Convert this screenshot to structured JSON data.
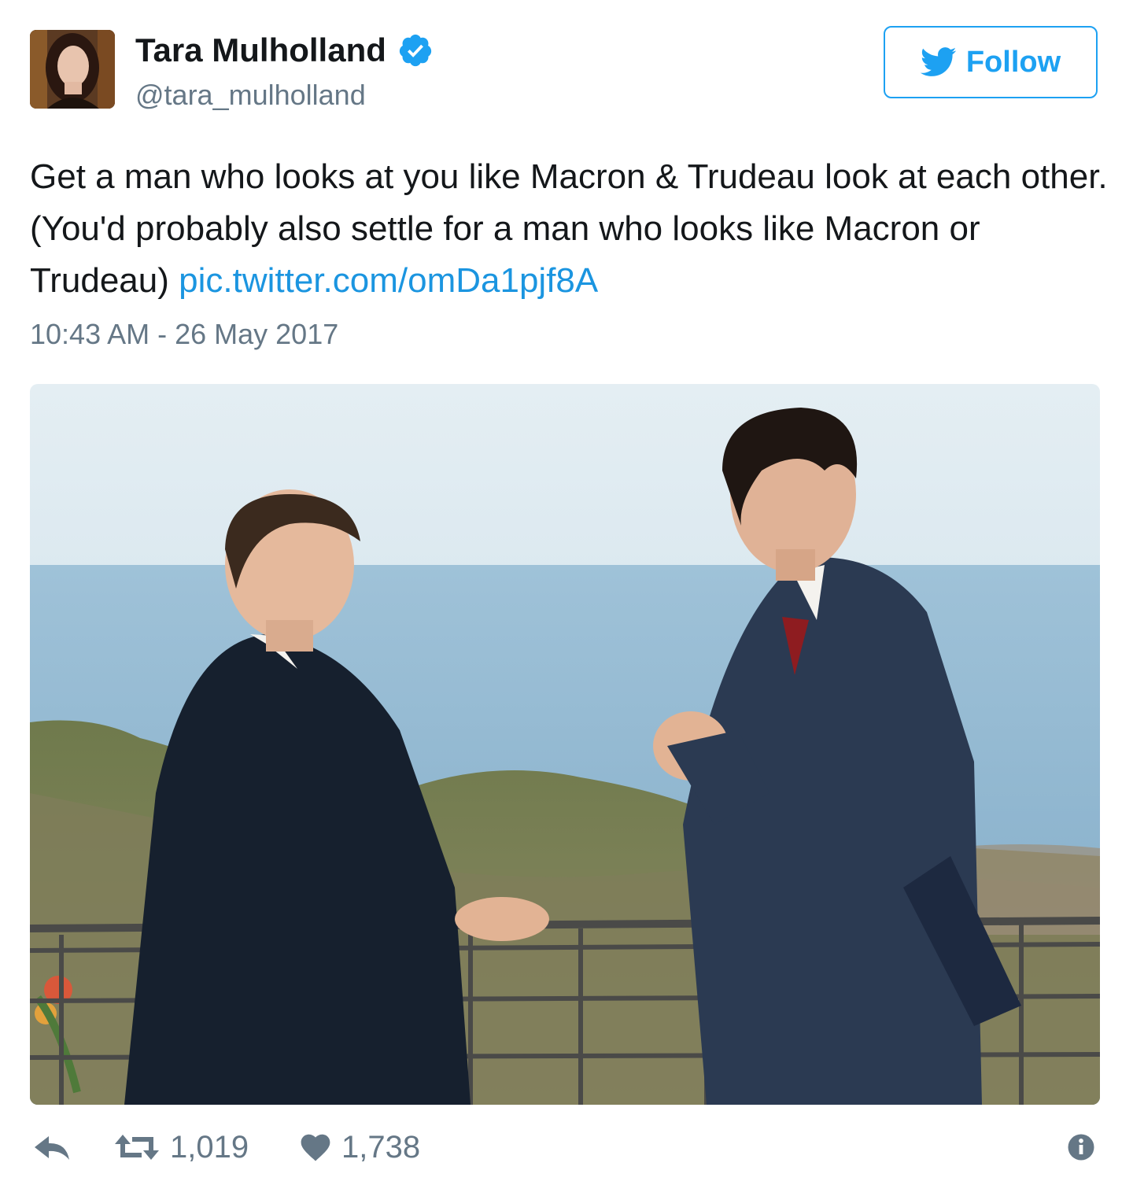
{
  "author": {
    "name": "Tara Mulholland",
    "handle": "@tara_mulholland",
    "verified": true
  },
  "follow_button": {
    "label": "Follow",
    "icon": "twitter-bird-icon"
  },
  "tweet": {
    "text": "Get a man who looks at you like Macron & Trudeau look at each other. (You'd probably also settle for a man who looks like Macron or Trudeau)",
    "link_text": "pic.twitter.com/omDa1pjf8A",
    "timestamp": "10:43 AM - 26 May 2017"
  },
  "actions": {
    "reply_icon": "reply-icon",
    "retweet_icon": "retweet-icon",
    "retweet_count": "1,019",
    "like_icon": "heart-icon",
    "like_count": "1,738",
    "info_icon": "info-icon"
  },
  "colors": {
    "accent": "#1da1f2",
    "link": "#1b95e0",
    "secondary_text": "#657786",
    "primary_text": "#14171a"
  }
}
